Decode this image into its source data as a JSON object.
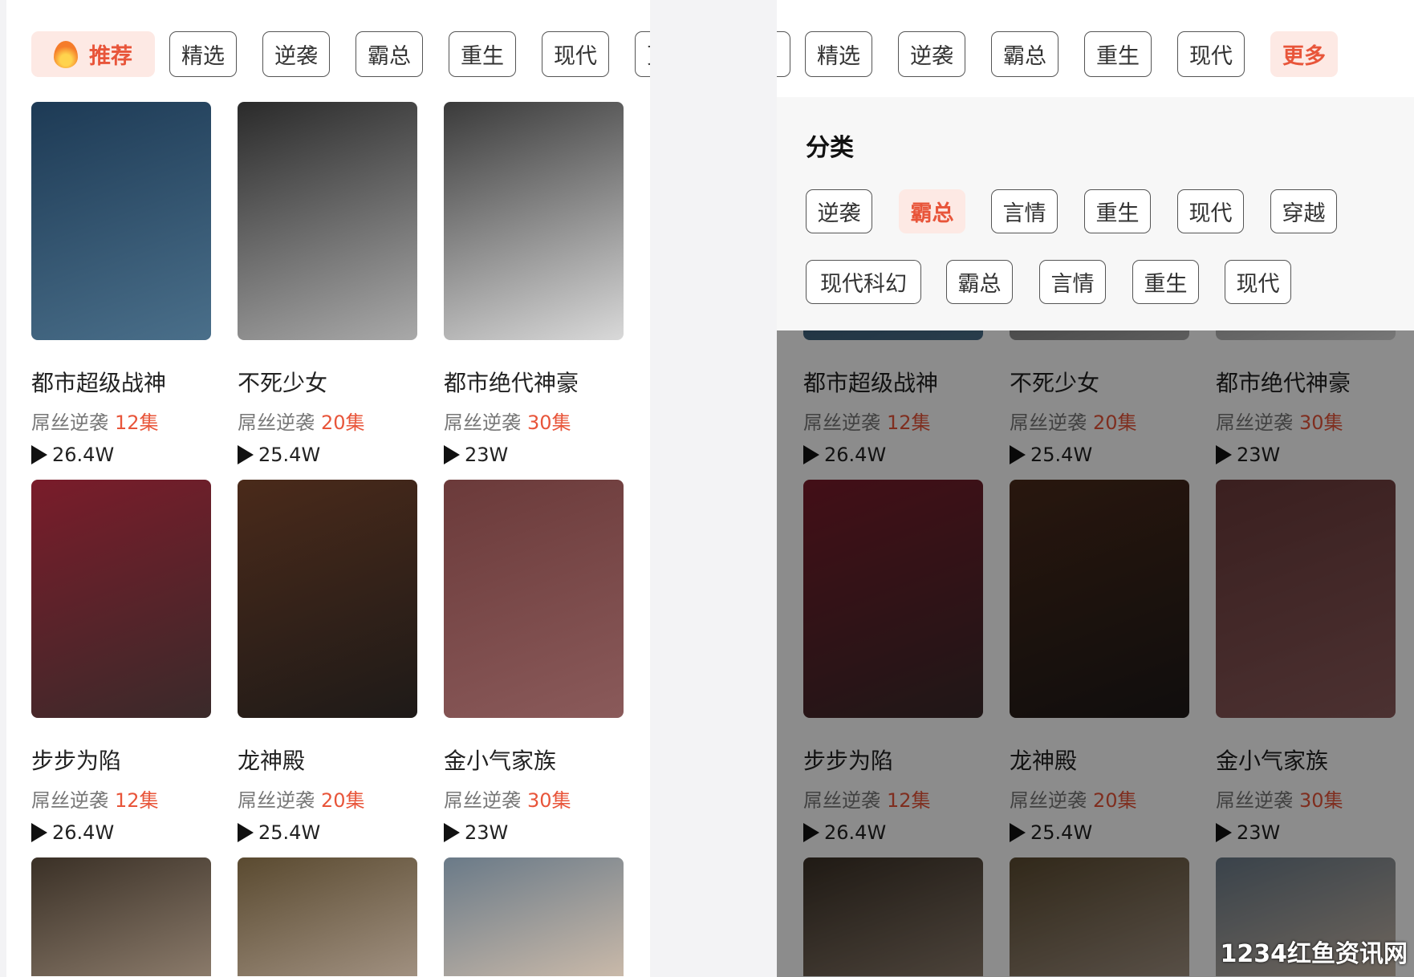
{
  "tabs": [
    {
      "label": "推荐",
      "active": true
    },
    {
      "label": "精选"
    },
    {
      "label": "逆袭"
    },
    {
      "label": "霸总"
    },
    {
      "label": "重生"
    },
    {
      "label": "现代"
    },
    {
      "label": "更多"
    }
  ],
  "more_active_label": "更多",
  "category_panel": {
    "title": "分类",
    "chips": [
      {
        "label": "逆袭"
      },
      {
        "label": "霸总",
        "active": true
      },
      {
        "label": "言情"
      },
      {
        "label": "重生"
      },
      {
        "label": "现代"
      },
      {
        "label": "穿越"
      },
      {
        "label": "现代科幻"
      },
      {
        "label": "霸总"
      },
      {
        "label": "言情"
      },
      {
        "label": "重生"
      },
      {
        "label": "现代"
      }
    ]
  },
  "dramas": [
    {
      "title": "都市超级战神",
      "tag": "屌丝逆袭",
      "episodes": "12集",
      "plays": "26.4W",
      "colors": [
        "#1d3a55",
        "#4a6f8a"
      ]
    },
    {
      "title": "不死少女",
      "tag": "屌丝逆袭",
      "episodes": "20集",
      "plays": "25.4W",
      "colors": [
        "#2a2a2a",
        "#a9a9a9"
      ]
    },
    {
      "title": "都市绝代神豪",
      "tag": "屌丝逆袭",
      "episodes": "30集",
      "plays": "23W",
      "colors": [
        "#3a3a3a",
        "#d9d9d9"
      ]
    },
    {
      "title": "步步为陷",
      "tag": "屌丝逆袭",
      "episodes": "12集",
      "plays": "26.4W",
      "colors": [
        "#7a1c2a",
        "#3a2a2a"
      ]
    },
    {
      "title": "龙神殿",
      "tag": "屌丝逆袭",
      "episodes": "20集",
      "plays": "25.4W",
      "colors": [
        "#4a2a1a",
        "#1e1a18"
      ]
    },
    {
      "title": "金小气家族",
      "tag": "屌丝逆袭",
      "episodes": "30集",
      "plays": "23W",
      "colors": [
        "#6b3a3a",
        "#8a5a5a"
      ]
    },
    {
      "colors": [
        "#3a3026",
        "#8a7a6a"
      ]
    },
    {
      "colors": [
        "#5a4a30",
        "#a09080"
      ]
    },
    {
      "colors": [
        "#6a7a88",
        "#c9b9a9"
      ]
    }
  ],
  "accent": "#e8553a",
  "watermark": "1234红鱼资讯网"
}
